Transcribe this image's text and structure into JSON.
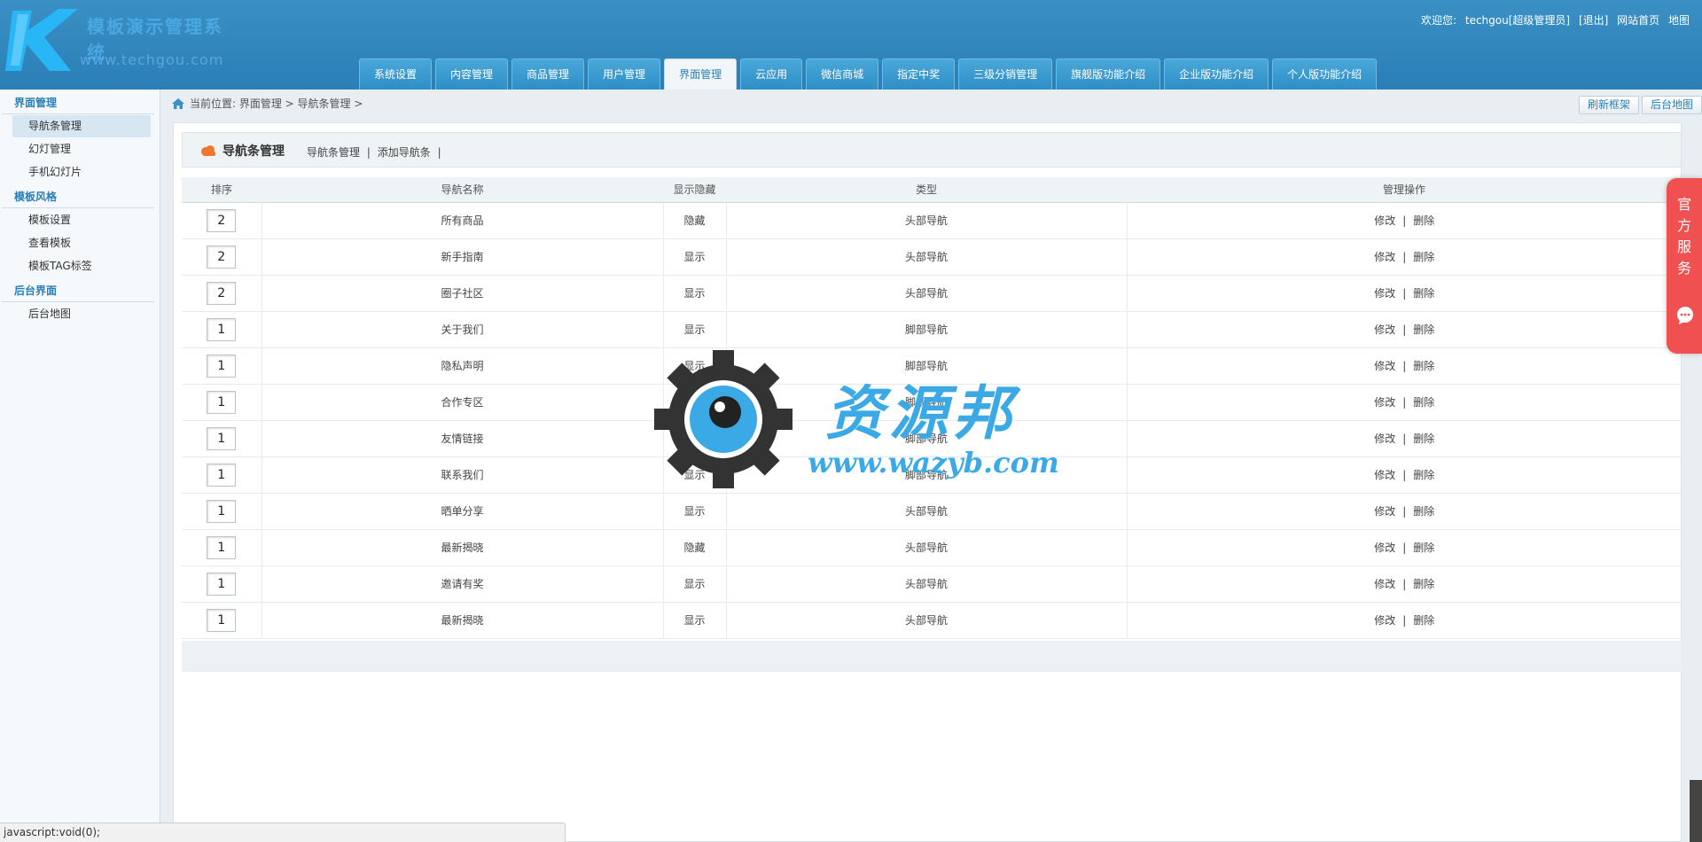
{
  "header": {
    "logo_title": "模板演示管理系统",
    "logo_url": "www.techgou.com",
    "user_bar": {
      "welcome": "欢迎您:",
      "username": "techgou",
      "role": "[超级管理员]",
      "logout": "[退出]",
      "site_home": "网站首页",
      "map": "地图"
    },
    "nav_tabs": [
      {
        "label": "系统设置",
        "active": false
      },
      {
        "label": "内容管理",
        "active": false
      },
      {
        "label": "商品管理",
        "active": false
      },
      {
        "label": "用户管理",
        "active": false
      },
      {
        "label": "界面管理",
        "active": true
      },
      {
        "label": "云应用",
        "active": false
      },
      {
        "label": "微信商城",
        "active": false
      },
      {
        "label": "指定中奖",
        "active": false
      },
      {
        "label": "三级分销管理",
        "active": false
      },
      {
        "label": "旗舰版功能介绍",
        "active": false
      },
      {
        "label": "企业版功能介绍",
        "active": false
      },
      {
        "label": "个人版功能介绍",
        "active": false
      }
    ]
  },
  "sidebar": {
    "groups": [
      {
        "title": "界面管理",
        "items": [
          {
            "label": "导航条管理",
            "active": true
          },
          {
            "label": "幻灯管理",
            "active": false
          },
          {
            "label": "手机幻灯片",
            "active": false
          }
        ]
      },
      {
        "title": "模板风格",
        "items": [
          {
            "label": "模板设置",
            "active": false
          },
          {
            "label": "查看模板",
            "active": false
          },
          {
            "label": "模板TAG标签",
            "active": false
          }
        ]
      },
      {
        "title": "后台界面",
        "items": [
          {
            "label": "后台地图",
            "active": false
          }
        ]
      }
    ]
  },
  "breadcrumb": {
    "text": "当前位置: 界面管理 > 导航条管理 >"
  },
  "top_buttons": {
    "refresh": "刷新框架",
    "admin_map": "后台地图"
  },
  "panel": {
    "title": "导航条管理",
    "links": [
      "导航条管理",
      "|",
      "添加导航条",
      "|"
    ]
  },
  "table": {
    "headers": [
      "排序",
      "导航名称",
      "显示隐藏",
      "类型",
      "管理操作"
    ],
    "edit_label": "修改",
    "sep": "|",
    "delete_label": "删除",
    "rows": [
      {
        "order": "2",
        "name": "所有商品",
        "visibility": "隐藏",
        "type": "头部导航"
      },
      {
        "order": "2",
        "name": "新手指南",
        "visibility": "显示",
        "type": "头部导航"
      },
      {
        "order": "2",
        "name": "圈子社区",
        "visibility": "显示",
        "type": "头部导航"
      },
      {
        "order": "1",
        "name": "关于我们",
        "visibility": "显示",
        "type": "脚部导航"
      },
      {
        "order": "1",
        "name": "隐私声明",
        "visibility": "显示",
        "type": "脚部导航"
      },
      {
        "order": "1",
        "name": "合作专区",
        "visibility": "显示",
        "type": "脚部导航"
      },
      {
        "order": "1",
        "name": "友情链接",
        "visibility": "显示",
        "type": "脚部导航"
      },
      {
        "order": "1",
        "name": "联系我们",
        "visibility": "显示",
        "type": "脚部导航"
      },
      {
        "order": "1",
        "name": "晒单分享",
        "visibility": "显示",
        "type": "头部导航"
      },
      {
        "order": "1",
        "name": "最新揭晓",
        "visibility": "隐藏",
        "type": "头部导航"
      },
      {
        "order": "1",
        "name": "邀请有奖",
        "visibility": "显示",
        "type": "头部导航"
      },
      {
        "order": "1",
        "name": "最新揭晓",
        "visibility": "显示",
        "type": "头部导航"
      }
    ]
  },
  "service_badge": {
    "text": "官方服务",
    "icon": "chat-icon"
  },
  "watermark": {
    "name": "资源邦",
    "url": "www.wazyb.com"
  },
  "status_bar": {
    "text": "javascript:void(0);"
  },
  "colors": {
    "header_blue": "#2a7fb6",
    "accent_blue": "#3ba9e6",
    "service_red": "#f05050"
  }
}
